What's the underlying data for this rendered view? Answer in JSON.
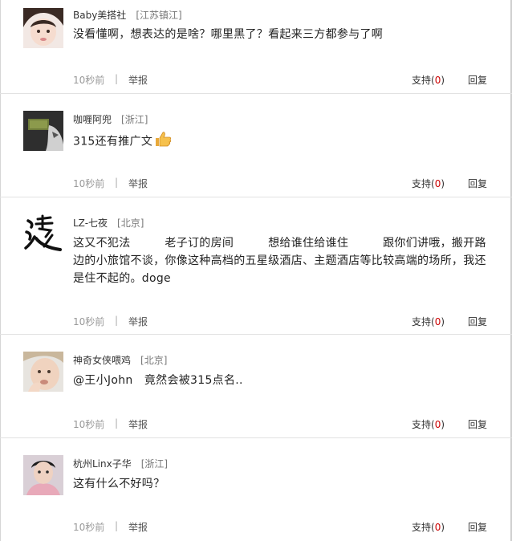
{
  "comments": [
    {
      "username": "Baby美搭社",
      "location": "[江苏镇江]",
      "text": "没看懂啊，想表达的是啥？哪里黑了？看起来三方都参与了啊",
      "time": "10秒前",
      "separator": "|",
      "report": "举报",
      "like_label": "支持(",
      "like_count": "0",
      "like_close": ")",
      "reply": "回复",
      "avatar_icon": "girl-avatar-icon"
    },
    {
      "username": "咖喱阿兜",
      "location": "[浙江]",
      "text": "315还有推广文",
      "time": "10秒前",
      "separator": "|",
      "report": "举报",
      "like_label": "支持(",
      "like_count": "0",
      "like_close": ")",
      "reply": "回复",
      "avatar_icon": "mask-avatar-icon",
      "emoji": "thumbs-up-icon"
    },
    {
      "username": "LZ-七夜",
      "location": "[北京]",
      "text": "这又不犯法　　　老子订的房间　　　想给谁住给谁住　　　跟你们讲哦，搬开路边的小旅馆不谈，你像这种高档的五星级酒店、主题酒店等比较高端的场所，我还是住不起的。doge",
      "time": "10秒前",
      "separator": "|",
      "report": "举报",
      "like_label": "支持(",
      "like_count": "0",
      "like_close": ")",
      "reply": "回复",
      "avatar_icon": "calligraphy-avatar-icon"
    },
    {
      "username": "神奇女侠喂鸡",
      "location": "[北京]",
      "text": "@王小John　竟然会被315点名..",
      "time": "10秒前",
      "separator": "|",
      "report": "举报",
      "like_label": "支持(",
      "like_count": "0",
      "like_close": ")",
      "reply": "回复",
      "avatar_icon": "child-avatar-icon"
    },
    {
      "username": "杭州Linx子华",
      "location": "[浙江]",
      "text": "这有什么不好吗？",
      "time": "10秒前",
      "separator": "|",
      "report": "举报",
      "like_label": "支持(",
      "like_count": "0",
      "like_close": ")",
      "reply": "回复",
      "avatar_icon": "man-avatar-icon"
    }
  ],
  "colors": {
    "like_count": "#cc0000",
    "divider": "#e2e2e2"
  }
}
